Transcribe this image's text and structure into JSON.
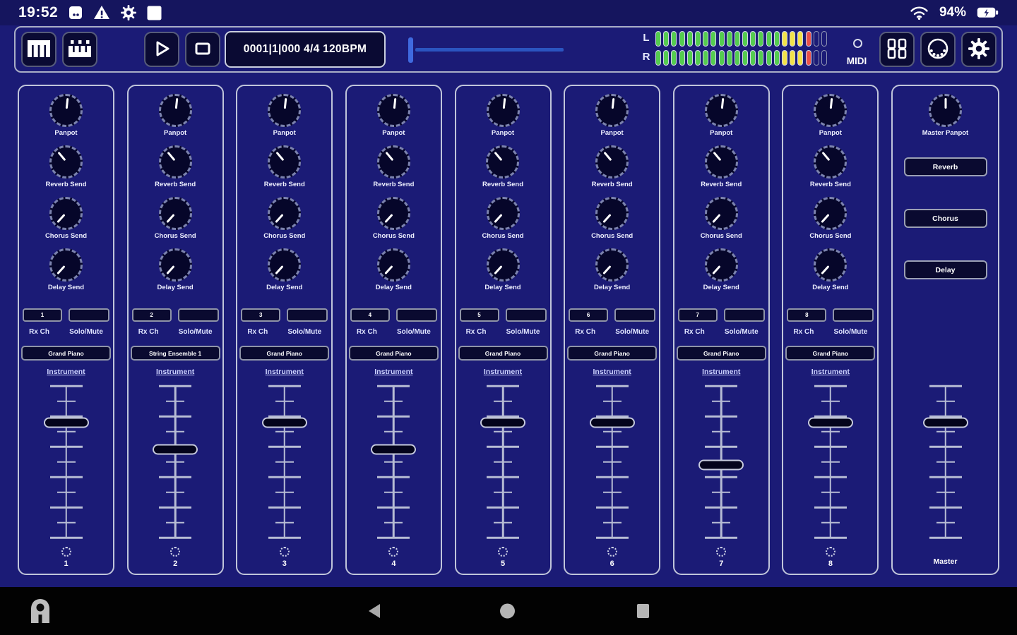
{
  "status_bar": {
    "time": "19:52",
    "battery_pct": "94%"
  },
  "toolbar": {
    "transport_display": "0001|1|000 4/4 120BPM",
    "midi_label": "MIDI",
    "meter": {
      "left_label": "L",
      "right_label": "R",
      "segment_total": 22,
      "green": 16,
      "yellow": 3,
      "red": 1
    }
  },
  "strip_labels": {
    "rx_ch": "Rx Ch",
    "solo_mute": "Solo/Mute",
    "instrument": "Instrument"
  },
  "knobs": [
    {
      "id": "panpot",
      "label": "Panpot",
      "angle": 6
    },
    {
      "id": "reverb-send",
      "label": "Reverb Send",
      "angle": -40
    },
    {
      "id": "chorus-send",
      "label": "Chorus Send",
      "angle": -138
    },
    {
      "id": "delay-send",
      "label": "Delay Send",
      "angle": -138
    }
  ],
  "channels": [
    {
      "number": "1",
      "rx_value": "1",
      "instrument": "Grand Piano",
      "fader_pct": 24
    },
    {
      "number": "2",
      "rx_value": "2",
      "instrument": "String Ensemble 1",
      "fader_pct": 42
    },
    {
      "number": "3",
      "rx_value": "3",
      "instrument": "Grand Piano",
      "fader_pct": 24
    },
    {
      "number": "4",
      "rx_value": "4",
      "instrument": "Grand Piano",
      "fader_pct": 42
    },
    {
      "number": "5",
      "rx_value": "5",
      "instrument": "Grand Piano",
      "fader_pct": 24
    },
    {
      "number": "6",
      "rx_value": "6",
      "instrument": "Grand Piano",
      "fader_pct": 24
    },
    {
      "number": "7",
      "rx_value": "7",
      "instrument": "Grand Piano",
      "fader_pct": 52
    },
    {
      "number": "8",
      "rx_value": "8",
      "instrument": "Grand Piano",
      "fader_pct": 24
    }
  ],
  "master": {
    "panpot_label": "Master Panpot",
    "panpot_angle": 0,
    "buttons": [
      "Reverb",
      "Chorus",
      "Delay"
    ],
    "fader_pct": 24,
    "label": "Master"
  },
  "colors": {
    "meter_green": "#55cc50",
    "meter_yellow": "#f2e24a",
    "meter_red": "#e8514a",
    "accent_blue": "#3f6adf"
  },
  "icons": {
    "status_bar": [
      "screenshot-icon",
      "warning-icon",
      "settings-icon",
      "app-square-icon",
      "wifi-icon",
      "battery-icon"
    ],
    "toolbar": [
      "keyboard-icon",
      "pads-icon",
      "play-icon",
      "stop-icon",
      "grid-88-icon",
      "midi-din-icon",
      "gear-icon"
    ],
    "nav_bar": [
      "launcher-icon",
      "back-icon",
      "home-icon",
      "recents-icon"
    ]
  }
}
